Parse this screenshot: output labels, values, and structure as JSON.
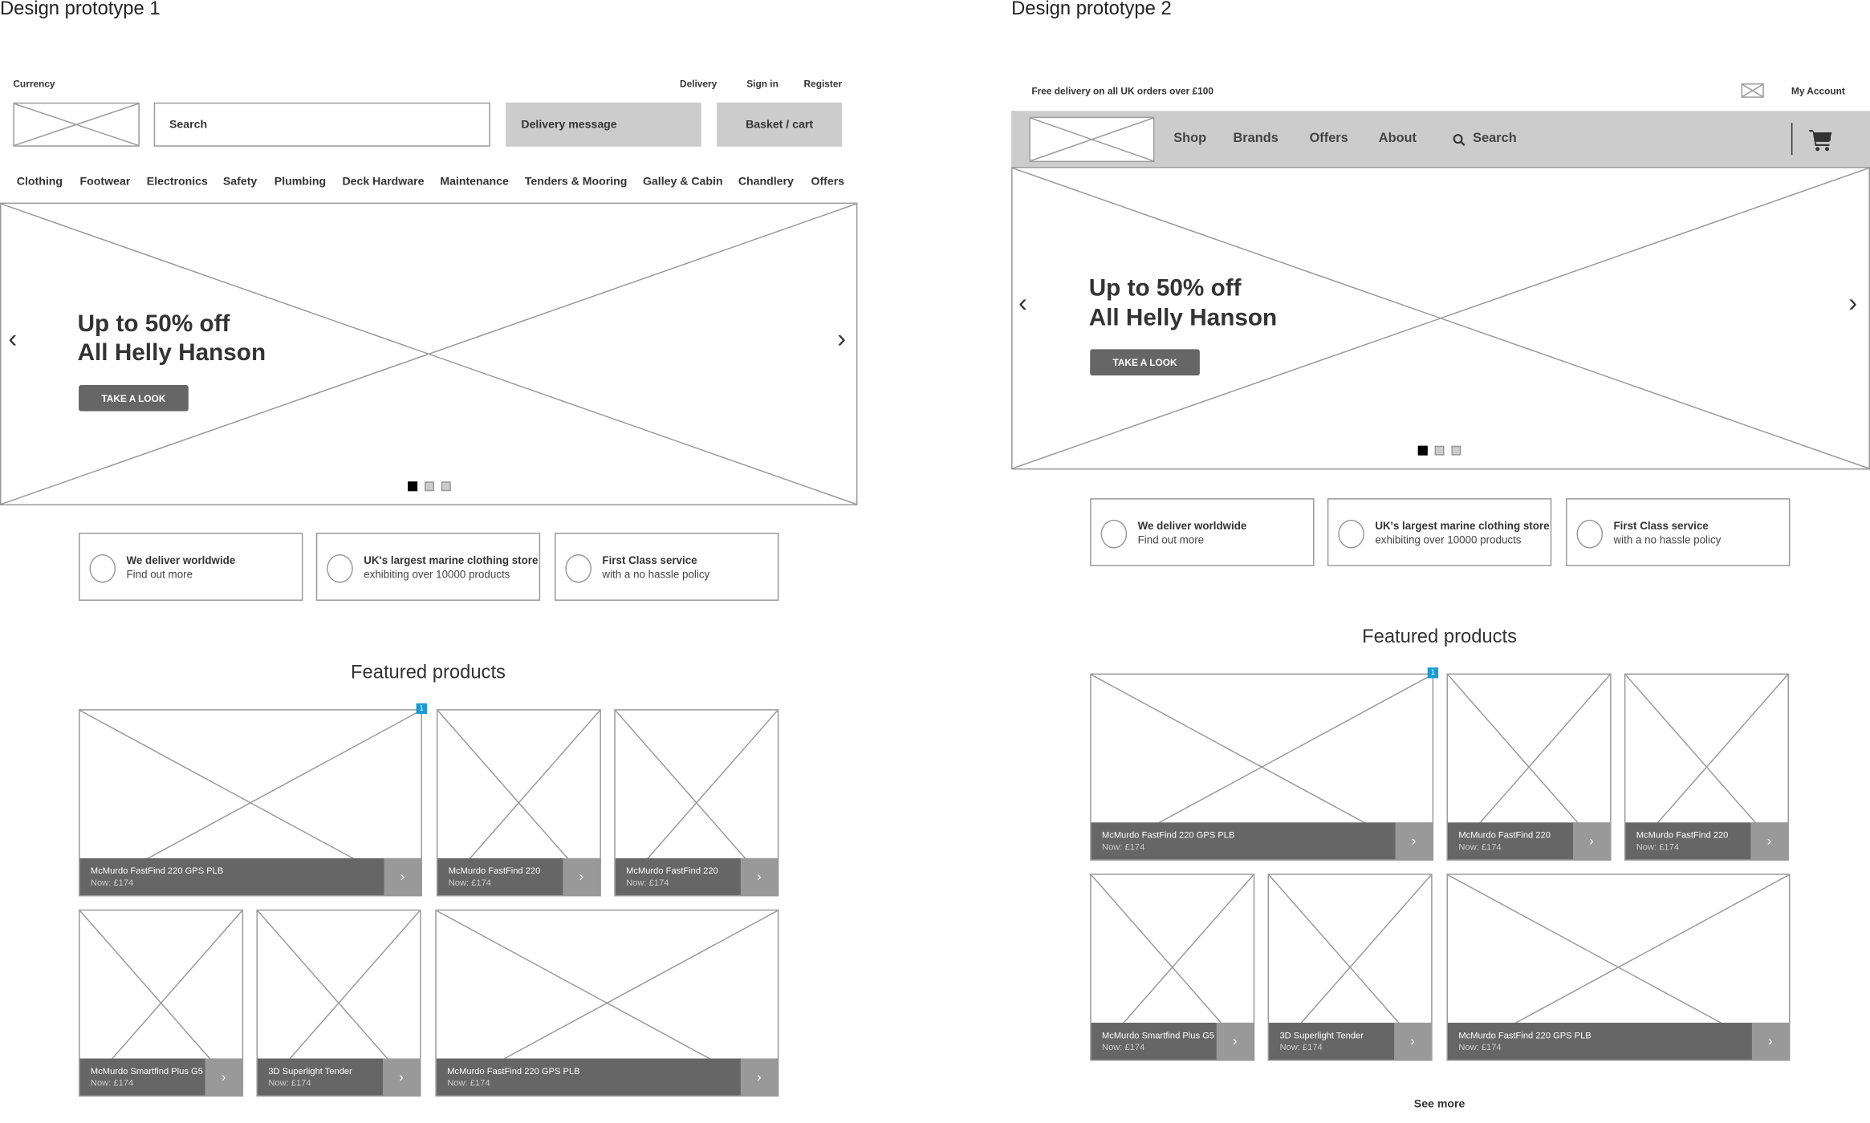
{
  "colors": {
    "placeholder_gray": "#cccccc",
    "caption_dark": "#666666",
    "badge_blue": "#1a9bd7"
  },
  "prototype1": {
    "title": "Design prototype 1",
    "top_links": {
      "currency": "Currency",
      "delivery": "Delivery",
      "sign_in": "Sign in",
      "register": "Register"
    },
    "search_placeholder": "Search",
    "delivery_message": "Delivery message",
    "basket": "Basket / cart",
    "nav": [
      "Clothing",
      "Footwear",
      "Electronics",
      "Safety",
      "Plumbing",
      "Deck Hardware",
      "Maintenance",
      "Tenders & Mooring",
      "Galley & Cabin",
      "Chandlery",
      "Offers"
    ],
    "hero": {
      "line1": "Up to 50% off",
      "line2": "All Helly Hanson",
      "cta": "TAKE A LOOK",
      "slides": 3,
      "active_slide": 1
    },
    "features": [
      {
        "title": "We deliver worldwide",
        "subtitle": "Find out more"
      },
      {
        "title": "UK's largest marine clothing store",
        "subtitle": "exhibiting over 10000 products"
      },
      {
        "title": "First Class service",
        "subtitle": "with a no hassle policy"
      }
    ],
    "featured_title": "Featured products",
    "badge": "1",
    "products": [
      {
        "name": "McMurdo FastFind 220 GPS PLB",
        "price": "Now: £174"
      },
      {
        "name": "McMurdo FastFind 220",
        "price": "Now: £174"
      },
      {
        "name": "McMurdo FastFind 220",
        "price": "Now: £174"
      },
      {
        "name": "McMurdo Smartfind Plus G5",
        "price": "Now: £174"
      },
      {
        "name": "3D Superlight Tender",
        "price": "Now: £174"
      },
      {
        "name": "McMurdo FastFind 220 GPS PLB",
        "price": "Now: £174"
      }
    ]
  },
  "prototype2": {
    "title": "Design prototype 2",
    "promo": "Free delivery on all UK orders over £100",
    "my_account": "My Account",
    "nav": [
      "Shop",
      "Brands",
      "Offers",
      "About"
    ],
    "search": "Search",
    "hero": {
      "line1": "Up to 50% off",
      "line2": "All Helly Hanson",
      "cta": "TAKE A LOOK",
      "slides": 3,
      "active_slide": 1
    },
    "features": [
      {
        "title": "We deliver worldwide",
        "subtitle": "Find out more"
      },
      {
        "title": "UK's largest marine clothing store",
        "subtitle": "exhibiting over 10000 products"
      },
      {
        "title": "First Class service",
        "subtitle": "with a no hassle policy"
      }
    ],
    "featured_title": "Featured products",
    "badge": "1",
    "products": [
      {
        "name": "McMurdo FastFind 220 GPS PLB",
        "price": "Now: £174"
      },
      {
        "name": "McMurdo FastFind 220",
        "price": "Now: £174"
      },
      {
        "name": "McMurdo FastFind 220",
        "price": "Now: £174"
      },
      {
        "name": "McMurdo Smartfind Plus G5",
        "price": "Now: £174"
      },
      {
        "name": "3D Superlight Tender",
        "price": "Now: £174"
      },
      {
        "name": "McMurdo FastFind 220 GPS PLB",
        "price": "Now: £174"
      }
    ],
    "see_more": "See more"
  }
}
